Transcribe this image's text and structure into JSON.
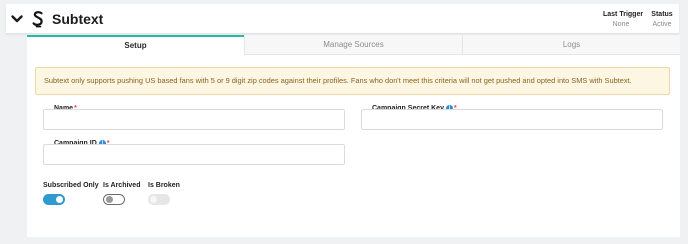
{
  "header": {
    "title": "Subtext",
    "last_trigger": {
      "label": "Last Trigger",
      "value": "None"
    },
    "status": {
      "label": "Status",
      "value": "Active"
    }
  },
  "tabs": [
    {
      "label": "Setup",
      "active": true
    },
    {
      "label": "Manage Sources",
      "active": false
    },
    {
      "label": "Logs",
      "active": false
    }
  ],
  "notice": "Subtext only supports pushing US based fans with 5 or 9 digit zip codes against their profiles. Fans who don't meet this criteria will not get pushed and opted into SMS with Subtext.",
  "form": {
    "name": {
      "label": "Name",
      "required_mark": "*",
      "value": ""
    },
    "campaign_secret_key": {
      "label": "Campaign Secret Key",
      "required_mark": "*",
      "value": ""
    },
    "campaign_id": {
      "label": "Campaign ID",
      "required_mark": "*",
      "value": ""
    }
  },
  "toggles": {
    "subscribed_only": {
      "label": "Subscribed Only",
      "on": true
    },
    "is_archived": {
      "label": "Is Archived",
      "on": false
    },
    "is_broken": {
      "label": "Is Broken",
      "on": false,
      "disabled": true
    }
  },
  "icons": {
    "collapse": "chevron-down-icon",
    "logo": "subtext-logo-icon",
    "info": "info-icon"
  },
  "colors": {
    "active_tab_accent": "#2bb7a5",
    "toggle_on": "#2e9ad0",
    "info_icon": "#2a8bd6",
    "required": "#e0403c",
    "notice_bg": "#fdf6e3",
    "notice_text": "#8a6220"
  }
}
